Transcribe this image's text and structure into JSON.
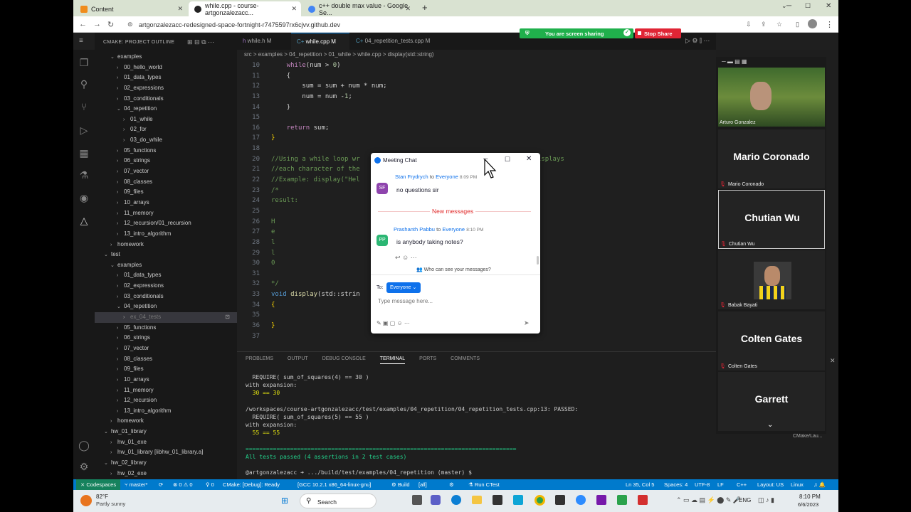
{
  "browser": {
    "tabs": [
      {
        "label": "Content"
      },
      {
        "label": "while.cpp - course-artgonzalezacc..."
      },
      {
        "label": "c++ double max value - Google Se..."
      }
    ],
    "url": "artgonzalezacc-redesigned-space-fortnight-r7475597rx6cjvv.github.dev"
  },
  "share_bar": {
    "sharing": "You are screen sharing",
    "stop": "Stop Share"
  },
  "sidebar": {
    "header": "CMAKE: PROJECT OUTLINE",
    "items": [
      {
        "label": "examples",
        "indent": 2,
        "chev": "v"
      },
      {
        "label": "00_hello_world",
        "indent": 3,
        "chev": ">"
      },
      {
        "label": "01_data_types",
        "indent": 3,
        "chev": ">"
      },
      {
        "label": "02_expressions",
        "indent": 3,
        "chev": ">"
      },
      {
        "label": "03_conditionals",
        "indent": 3,
        "chev": ">"
      },
      {
        "label": "04_repetition",
        "indent": 3,
        "chev": "v"
      },
      {
        "label": "01_while",
        "indent": 4,
        "chev": ">"
      },
      {
        "label": "02_for",
        "indent": 4,
        "chev": ">"
      },
      {
        "label": "03_do_while",
        "indent": 4,
        "chev": ">"
      },
      {
        "label": "05_functions",
        "indent": 3,
        "chev": ">"
      },
      {
        "label": "06_strings",
        "indent": 3,
        "chev": ">"
      },
      {
        "label": "07_vector",
        "indent": 3,
        "chev": ">"
      },
      {
        "label": "08_classes",
        "indent": 3,
        "chev": ">"
      },
      {
        "label": "09_files",
        "indent": 3,
        "chev": ">"
      },
      {
        "label": "10_arrays",
        "indent": 3,
        "chev": ">"
      },
      {
        "label": "11_memory",
        "indent": 3,
        "chev": ">"
      },
      {
        "label": "12_recursion/01_recursion",
        "indent": 3,
        "chev": ">"
      },
      {
        "label": "13_intro_algorithm",
        "indent": 3,
        "chev": ">"
      },
      {
        "label": "homework",
        "indent": 2,
        "chev": ">"
      },
      {
        "label": "test",
        "indent": 1,
        "chev": "v"
      },
      {
        "label": "examples",
        "indent": 2,
        "chev": "v"
      },
      {
        "label": "01_data_types",
        "indent": 3,
        "chev": ">"
      },
      {
        "label": "02_expressions",
        "indent": 3,
        "chev": ">"
      },
      {
        "label": "03_conditionals",
        "indent": 3,
        "chev": ">"
      },
      {
        "label": "04_repetition",
        "indent": 3,
        "chev": "v"
      },
      {
        "label": "ex_04_tests",
        "indent": 4,
        "chev": ">",
        "selected": true
      },
      {
        "label": "05_functions",
        "indent": 3,
        "chev": ">"
      },
      {
        "label": "06_strings",
        "indent": 3,
        "chev": ">"
      },
      {
        "label": "07_vector",
        "indent": 3,
        "chev": ">"
      },
      {
        "label": "08_classes",
        "indent": 3,
        "chev": ">"
      },
      {
        "label": "09_files",
        "indent": 3,
        "chev": ">"
      },
      {
        "label": "10_arrays",
        "indent": 3,
        "chev": ">"
      },
      {
        "label": "11_memory",
        "indent": 3,
        "chev": ">"
      },
      {
        "label": "12_recursion",
        "indent": 3,
        "chev": ">"
      },
      {
        "label": "13_intro_algorithm",
        "indent": 3,
        "chev": ">"
      },
      {
        "label": "homework",
        "indent": 2,
        "chev": ">"
      },
      {
        "label": "hw_01_library",
        "indent": 1,
        "chev": "v"
      },
      {
        "label": "hw_01_exe",
        "indent": 2,
        "chev": ">"
      },
      {
        "label": "hw_01_library [libhw_01_library.a]",
        "indent": 2,
        "chev": ">"
      },
      {
        "label": "hw_02_library",
        "indent": 1,
        "chev": "v"
      },
      {
        "label": "hw_02_exe",
        "indent": 2,
        "chev": ">"
      }
    ]
  },
  "editor": {
    "tabs": [
      {
        "label": "while.h  M"
      },
      {
        "label": "while.cpp  M"
      },
      {
        "label": "04_repetition_tests.cpp  M"
      }
    ],
    "breadcrumb": "src > examples > 04_repetition > 01_while > while.cpp > display(std::string)",
    "lines": [
      {
        "n": "10",
        "parts": [
          [
            "pl",
            "    "
          ],
          [
            "kw",
            "while"
          ],
          [
            "pl",
            "(num > "
          ],
          [
            "num",
            "0"
          ],
          [
            "pl",
            ")"
          ]
        ]
      },
      {
        "n": "11",
        "parts": [
          [
            "pl",
            "    {"
          ]
        ]
      },
      {
        "n": "12",
        "parts": [
          [
            "pl",
            "        sum = sum + num * num;"
          ]
        ]
      },
      {
        "n": "13",
        "parts": [
          [
            "pl",
            "        num = num -"
          ],
          [
            "num",
            "1"
          ],
          [
            "pl",
            ";"
          ]
        ]
      },
      {
        "n": "14",
        "parts": [
          [
            "pl",
            "    }"
          ]
        ]
      },
      {
        "n": "15",
        "parts": [
          [
            "pl",
            ""
          ]
        ]
      },
      {
        "n": "16",
        "parts": [
          [
            "pl",
            "    "
          ],
          [
            "kw",
            "return"
          ],
          [
            "pl",
            " sum;"
          ]
        ]
      },
      {
        "n": "17",
        "parts": [
          [
            "br",
            "}"
          ]
        ]
      },
      {
        "n": "18",
        "parts": [
          [
            "pl",
            ""
          ]
        ]
      },
      {
        "n": "20",
        "parts": [
          [
            "cm",
            "//Using a while loop wr"
          ],
          [
            "pl",
            "                             "
          ],
          [
            "cm",
            "ts a string and displays"
          ]
        ]
      },
      {
        "n": "21",
        "parts": [
          [
            "cm",
            "//each character of the"
          ]
        ]
      },
      {
        "n": "22",
        "parts": [
          [
            "cm",
            "//Example: display(\"Hel"
          ]
        ]
      },
      {
        "n": "23",
        "parts": [
          [
            "cm",
            "/*"
          ]
        ]
      },
      {
        "n": "24",
        "parts": [
          [
            "cm",
            "result:"
          ]
        ]
      },
      {
        "n": "25",
        "parts": [
          [
            "pl",
            ""
          ]
        ]
      },
      {
        "n": "26",
        "parts": [
          [
            "cm",
            "H"
          ]
        ]
      },
      {
        "n": "27",
        "parts": [
          [
            "cm",
            "e"
          ]
        ]
      },
      {
        "n": "28",
        "parts": [
          [
            "cm",
            "l"
          ]
        ]
      },
      {
        "n": "29",
        "parts": [
          [
            "cm",
            "l"
          ]
        ]
      },
      {
        "n": "30",
        "parts": [
          [
            "cm",
            "0"
          ]
        ]
      },
      {
        "n": "31",
        "parts": [
          [
            "pl",
            ""
          ]
        ]
      },
      {
        "n": "32",
        "parts": [
          [
            "cm",
            "*/"
          ]
        ]
      },
      {
        "n": "33",
        "parts": [
          [
            "ty",
            "void"
          ],
          [
            "pl",
            " "
          ],
          [
            "fn",
            "display"
          ],
          [
            "pl",
            "(std::strin"
          ]
        ]
      },
      {
        "n": "34",
        "parts": [
          [
            "br",
            "{"
          ]
        ]
      },
      {
        "n": "35",
        "parts": [
          [
            "pl",
            ""
          ]
        ]
      },
      {
        "n": "36",
        "parts": [
          [
            "br",
            "}"
          ]
        ]
      },
      {
        "n": "37",
        "parts": [
          [
            "pl",
            ""
          ]
        ]
      }
    ]
  },
  "panel": {
    "tabs": [
      "PROBLEMS",
      "OUTPUT",
      "DEBUG CONSOLE",
      "TERMINAL",
      "PORTS",
      "COMMENTS"
    ],
    "active_tab": "TERMINAL",
    "terminal": [
      {
        "c": "#ccc",
        "t": "  REQUIRE( sum_of_squares(4) == 30 )"
      },
      {
        "c": "#ccc",
        "t": "with expansion:"
      },
      {
        "c": "#e5e510",
        "t": "  30 == 30"
      },
      {
        "c": "#ccc",
        "t": ""
      },
      {
        "c": "#ccc",
        "t": "/workspaces/course-artgonzalezacc/test/examples/04_repetition/04_repetition_tests.cpp:13: PASSED:"
      },
      {
        "c": "#ccc",
        "t": "  REQUIRE( sum_of_squares(5) == 55 )"
      },
      {
        "c": "#ccc",
        "t": "with expansion:"
      },
      {
        "c": "#e5e510",
        "t": "  55 == 55"
      },
      {
        "c": "#ccc",
        "t": ""
      },
      {
        "c": "#23d18b",
        "t": "==============================================================================="
      },
      {
        "c": "#23d18b",
        "t": "All tests passed (4 assertions in 2 test cases)"
      },
      {
        "c": "#ccc",
        "t": ""
      },
      {
        "c": "#ccc",
        "t": "@artgonzalezacc ➜ .../build/test/examples/04_repetition (master) $ "
      }
    ]
  },
  "statusbar": {
    "codespaces": "Codespaces",
    "branch": "master*",
    "errors": "⊗ 0 ⚠ 0",
    "ports": "0",
    "cmake": "CMake: [Debug]: Ready",
    "kit": "[GCC 10.2.1 x86_64-linux-gnu]",
    "build": "Build",
    "target": "[all]",
    "ctest": "Run CTest",
    "position": "Ln 35, Col 5",
    "spaces": "Spaces: 4",
    "encoding": "UTF-8",
    "eol": "LF",
    "lang": "C++",
    "layout": "Layout: US",
    "os": "Linux"
  },
  "zoom": {
    "participants": [
      {
        "big": "",
        "small": "Arturo Gonzalez",
        "video": true
      },
      {
        "big": "Mario Coronado",
        "small": "Mario Coronado"
      },
      {
        "big": "Chutian Wu",
        "small": "Chutian Wu",
        "active": true
      },
      {
        "big": "",
        "small": "Babak Bayati",
        "photo": true
      },
      {
        "big": "Colten Gates",
        "small": "Colten Gates"
      },
      {
        "big": "Garrett",
        "small": ""
      }
    ],
    "overflow": "CMake/Lau..."
  },
  "chat": {
    "title": "Meeting Chat",
    "msg1_from": "Stan Frydrych",
    "msg1_to": "Everyone",
    "msg1_time": "8:09 PM",
    "msg1_initials": "SF",
    "msg1_text": "no questions sir",
    "new_messages": "New messages",
    "msg2_from": "Prashanth Pabbu",
    "msg2_to": "Everyone",
    "msg2_time": "8:10 PM",
    "msg2_initials": "PP",
    "msg2_text": "is anybody taking notes?",
    "who_can_see": "Who can see your messages?",
    "to_label": "To:",
    "to_value": "Everyone",
    "to_word": "to",
    "placeholder": "Type message here..."
  },
  "taskbar": {
    "weather_temp": "82°F",
    "weather_desc": "Partly sunny",
    "search": "Search",
    "lang": "ENG",
    "time": "8:10 PM",
    "date": "6/6/2023"
  },
  "colors": {
    "accent": "#007acc",
    "share_green": "#20b04c",
    "share_red": "#e02535",
    "chat_link": "#0e71eb",
    "new_msg": "#e02828"
  }
}
